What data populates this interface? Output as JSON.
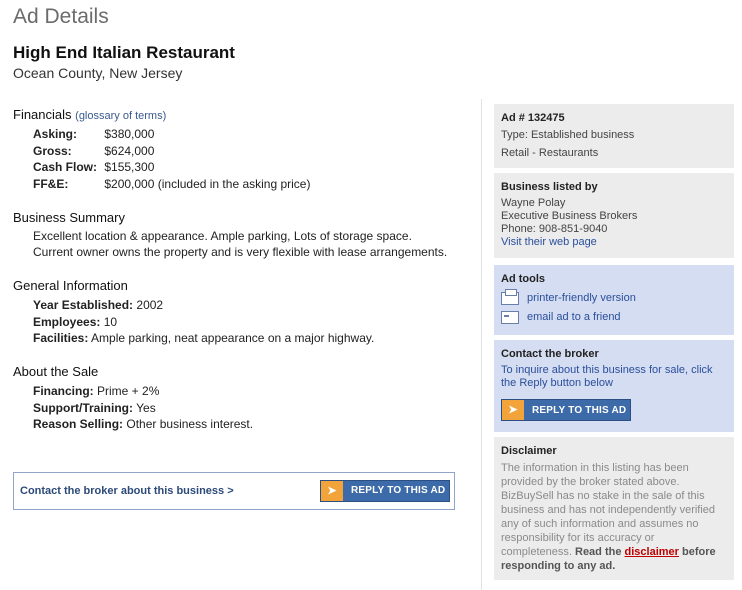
{
  "page": {
    "title": "Ad Details"
  },
  "listing": {
    "title": "High End Italian Restaurant",
    "location": "Ocean County, New Jersey"
  },
  "financials": {
    "heading": "Financials",
    "glossary_link": "(glossary of terms)",
    "rows": [
      {
        "label": "Asking:",
        "value": "$380,000"
      },
      {
        "label": "Gross:",
        "value": "$624,000"
      },
      {
        "label": "Cash Flow:",
        "value": "$155,300"
      },
      {
        "label": "FF&E:",
        "value": "$200,000 (included in the asking price)"
      }
    ]
  },
  "summary": {
    "heading": "Business Summary",
    "line1": "Excellent location & appearance. Ample parking, Lots of storage space.",
    "line2": "Current owner owns the property and is very flexible with lease arrangements."
  },
  "general": {
    "heading": "General Information",
    "rows": [
      {
        "label": "Year Established:",
        "value": "2002"
      },
      {
        "label": "Employees:",
        "value": "10"
      },
      {
        "label": "Facilities:",
        "value": "Ample parking, neat appearance on a major highway."
      }
    ]
  },
  "sale": {
    "heading": "About the Sale",
    "rows": [
      {
        "label": "Financing:",
        "value": "Prime + 2%"
      },
      {
        "label": "Support/Training:",
        "value": "Yes"
      },
      {
        "label": "Reason Selling:",
        "value": "Other business interest."
      }
    ]
  },
  "contact_box": {
    "label": "Contact the broker about this business >",
    "button": "REPLY TO THIS AD"
  },
  "sidebar": {
    "ad": {
      "number": "Ad # 132475",
      "type": "Type: Established business",
      "category": "Retail - Restaurants"
    },
    "broker": {
      "heading": "Business listed by",
      "name": "Wayne Polay",
      "company": "Executive Business Brokers",
      "phone": "Phone: 908-851-9040",
      "website_link": "Visit their web page"
    },
    "tools": {
      "heading": "Ad tools",
      "print": "printer-friendly version",
      "email": "email ad to a friend"
    },
    "contact": {
      "heading": "Contact the broker",
      "text": "To inquire about this business for sale, click the Reply button below",
      "button": "REPLY TO THIS AD"
    },
    "disclaimer": {
      "heading": "Disclaimer",
      "text": "The information in this listing has been provided by the broker stated above. BizBuySell has no stake in the sale of this business and has not independently verified any of such information and assumes no responsibility for its accuracy or completeness.",
      "read_prefix": "Read the",
      "link": "disclaimer",
      "read_suffix": "before responding to any ad."
    }
  },
  "colors": {
    "link": "#2b4f9c",
    "button": "#3d6aa8",
    "button_arrow": "#f2a33a",
    "panel_gray": "#ececec",
    "panel_blue": "#d4ddf1",
    "disclaimer_link": "#c00000"
  }
}
